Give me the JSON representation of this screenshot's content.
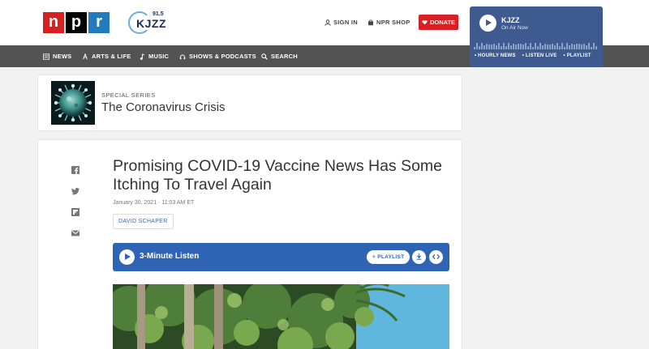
{
  "brand": {
    "npr_letters": [
      "n",
      "p",
      "r"
    ],
    "station_logo": "KJZZ",
    "station_freq": "91.5"
  },
  "header_links": {
    "sign_in": "SIGN IN",
    "shop": "NPR SHOP",
    "donate": "DONATE"
  },
  "nav": {
    "items": [
      {
        "label": "NEWS",
        "icon": "news-icon"
      },
      {
        "label": "ARTS & LIFE",
        "icon": "arts-icon"
      },
      {
        "label": "MUSIC",
        "icon": "music-icon"
      },
      {
        "label": "SHOWS & PODCASTS",
        "icon": "headphones-icon"
      },
      {
        "label": "SEARCH",
        "icon": "search-icon"
      }
    ]
  },
  "player": {
    "station": "KJZZ",
    "status": "On Air Now",
    "links": [
      "• HOURLY NEWS",
      "• LISTEN LIVE",
      "• PLAYLIST"
    ]
  },
  "series": {
    "label": "SPECIAL SERIES",
    "title": "The Coronavirus Crisis"
  },
  "article": {
    "headline": "Promising COVID-19 Vaccine News Has Some Itching To Travel Again",
    "date": "January 30, 2021 · 11:03 AM ET",
    "byline": "DAVID SCHAPER",
    "listen_label": "3-Minute Listen",
    "playlist_button": "+ PLAYLIST",
    "download_icon": "download-icon",
    "embed_icon": "embed-icon",
    "share_icons": [
      "facebook-icon",
      "twitter-icon",
      "flipboard-icon",
      "email-icon"
    ]
  },
  "colors": {
    "npr_red": "#d62021",
    "npr_blue": "#237bbd",
    "nav_bg": "#535353",
    "player_bg": "#3f5a8e",
    "listen_bg": "#2f64b4"
  }
}
